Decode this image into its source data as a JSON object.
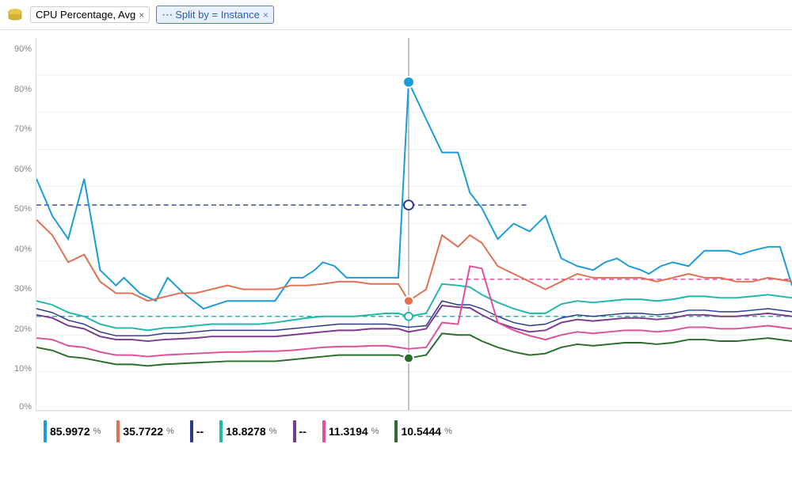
{
  "toolbar": {
    "metric_label": "CPU Percentage, Avg",
    "metric_close": "×",
    "split_icon": "⋯",
    "split_label": "Split by = Instance",
    "split_close": "×"
  },
  "yaxis": {
    "labels": [
      "90%",
      "80%",
      "70%",
      "60%",
      "50%",
      "40%",
      "30%",
      "20%",
      "10%",
      "0%"
    ]
  },
  "legend": {
    "items": [
      {
        "color": "#1a9cd8",
        "value": "85.9972",
        "unit": "%"
      },
      {
        "color": "#e07050",
        "value": "35.7722",
        "unit": "%"
      },
      {
        "color": "#2c3a8c",
        "value": "--",
        "unit": ""
      },
      {
        "color": "#20b8a8",
        "value": "18.8278",
        "unit": "%"
      },
      {
        "color": "#7c3a8c",
        "value": "--",
        "unit": ""
      },
      {
        "color": "#e0509a",
        "value": "11.3194",
        "unit": "%"
      },
      {
        "color": "#2a6e2a",
        "value": "10.5444",
        "unit": "%"
      }
    ]
  }
}
